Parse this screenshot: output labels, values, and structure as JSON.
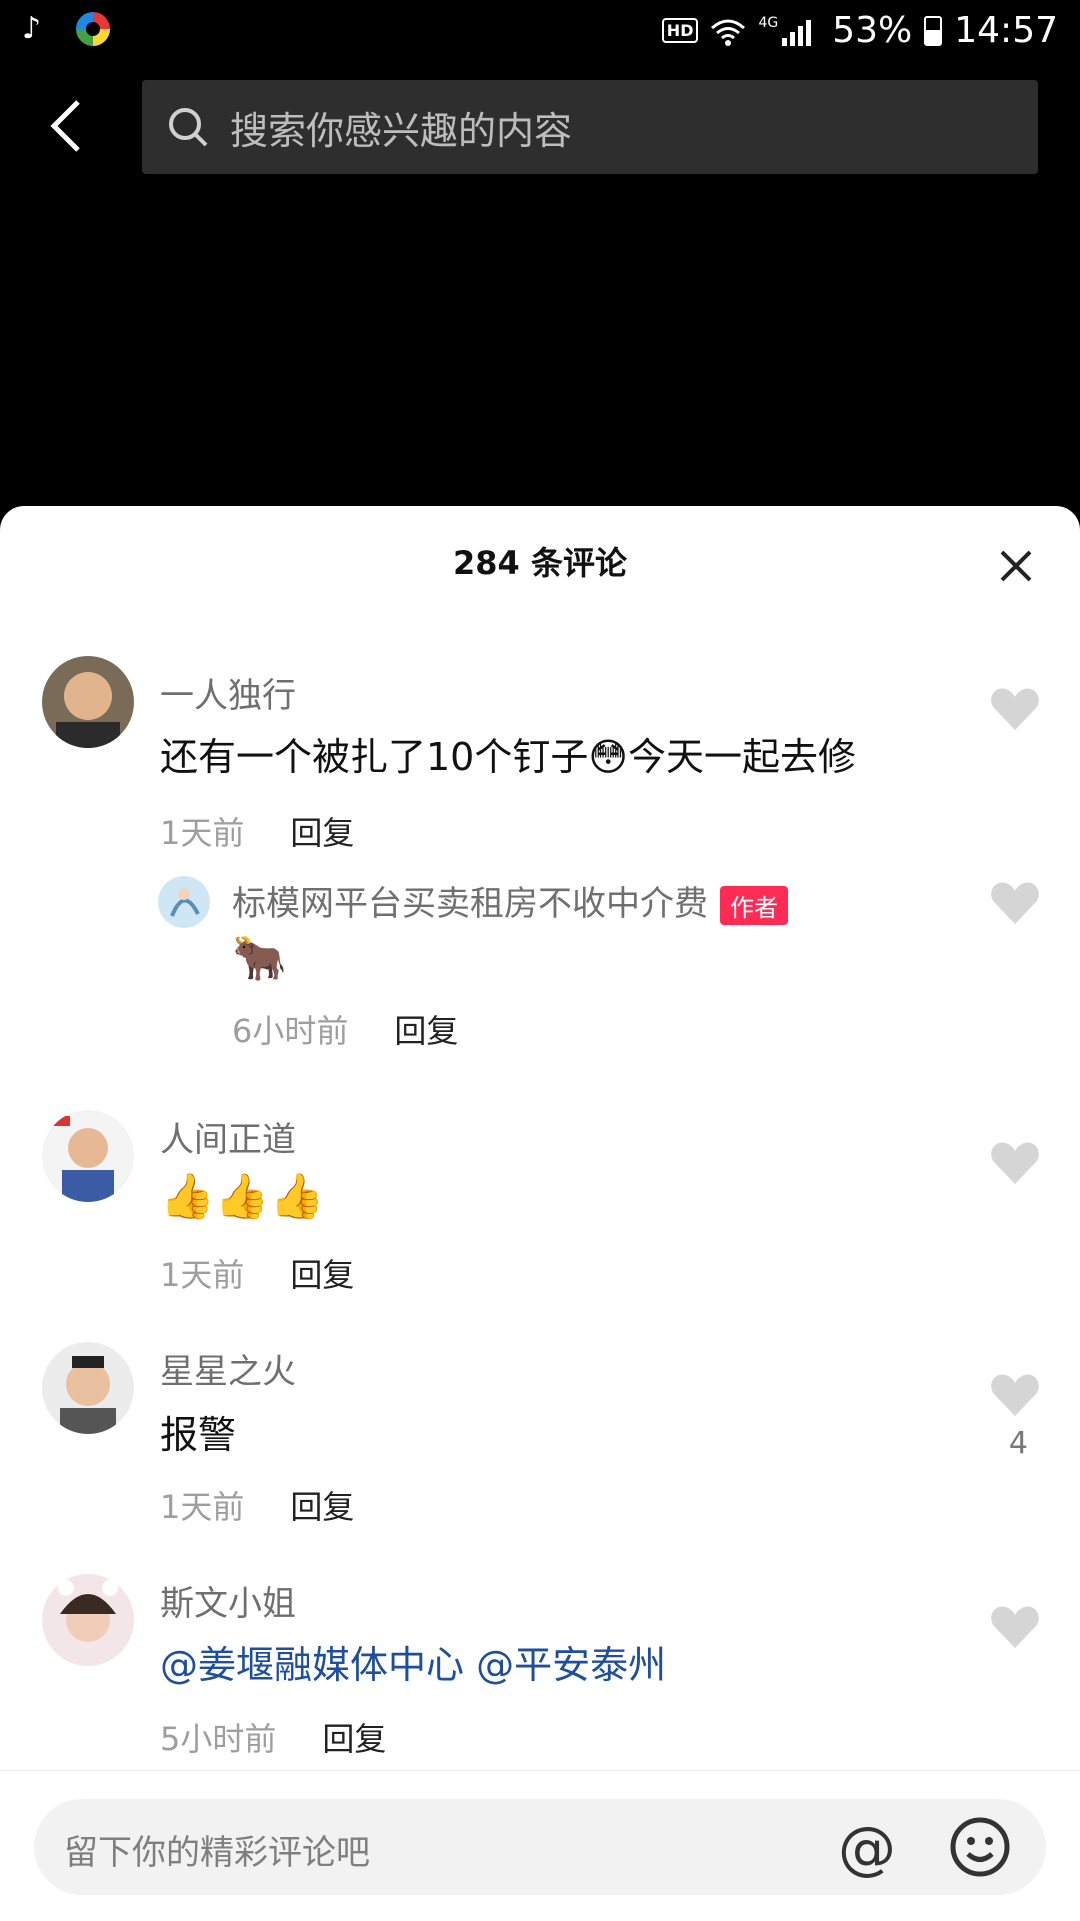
{
  "status_bar": {
    "hd": "HD",
    "network": "4G",
    "battery": "53%",
    "time": "14:57",
    "battery_level": 0.53
  },
  "search": {
    "placeholder": "搜索你感兴趣的内容"
  },
  "comments_panel": {
    "title": "284 条评论",
    "reply_label": "回复",
    "author_badge": "作者",
    "comments": [
      {
        "username": "一人独行",
        "text_before": "还有一个被扎了10个钉子",
        "emoji": "😳",
        "text_after": "今天一起去修",
        "time": "1天前"
      },
      {
        "username": "标模网平台买卖租房不收中介费",
        "text": "🐂",
        "time": "6小时前"
      },
      {
        "username": "人间正道",
        "text": "👍👍👍",
        "time": "1天前"
      },
      {
        "username": "星星之火",
        "text": "报警",
        "time": "1天前",
        "likes": "4"
      },
      {
        "username": "斯文小姐",
        "mentions": [
          "@姜堰融媒体中心",
          "@平安泰州"
        ],
        "time": "5小时前"
      }
    ]
  },
  "comment_input": {
    "placeholder": "留下你的精彩评论吧",
    "at_symbol": "@"
  },
  "colors": {
    "author_badge": "#fe2c55",
    "mention": "#1f4e9c",
    "heart": "#d5d5d5"
  }
}
